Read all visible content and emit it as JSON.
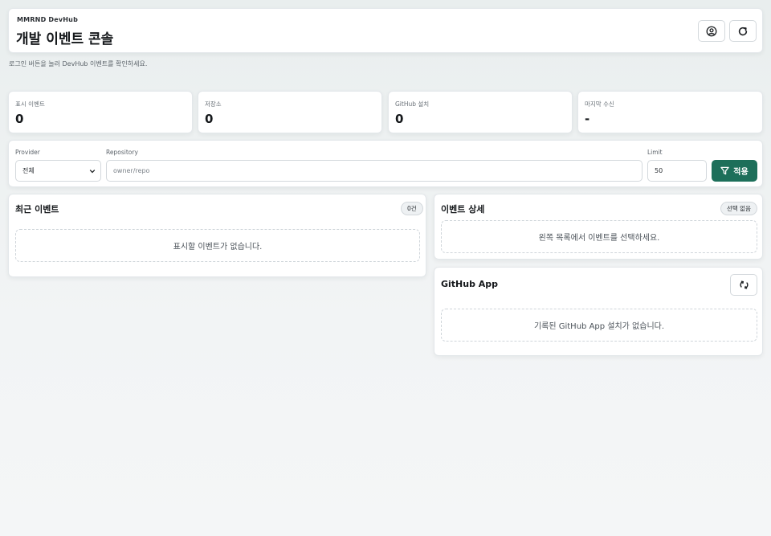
{
  "header": {
    "brand": "MMRND DevHub",
    "title": "개발 이벤트 콘솔"
  },
  "hint": "로그인 버튼을 눌러 DevHub 이벤트를 확인하세요.",
  "stats": [
    {
      "label": "표시 이벤트",
      "value": "0"
    },
    {
      "label": "저장소",
      "value": "0"
    },
    {
      "label": "GitHub 설치",
      "value": "0"
    },
    {
      "label": "마지막 수신",
      "value": "-"
    }
  ],
  "filters": {
    "provider_label": "Provider",
    "provider_value": "전체",
    "repository_label": "Repository",
    "repository_placeholder": "owner/repo",
    "limit_label": "Limit",
    "limit_value": "50",
    "apply_label": "적용"
  },
  "recent": {
    "title": "최근 이벤트",
    "badge": "0건",
    "empty": "표시할 이벤트가 없습니다."
  },
  "detail": {
    "title": "이벤트 상세",
    "badge": "선택 없음",
    "empty": "왼쪽 목록에서 이벤트를 선택하세요."
  },
  "github_app": {
    "title": "GitHub App",
    "empty": "기록된 GitHub App 설치가 없습니다."
  },
  "colors": {
    "accent": "#1d6f5a",
    "background": "#eef1f2"
  },
  "icons": {
    "account": "user-circle-icon",
    "refresh": "refresh-icon",
    "filter": "filter-icon",
    "sync": "sync-icon",
    "select": "chevron-down-icon"
  }
}
